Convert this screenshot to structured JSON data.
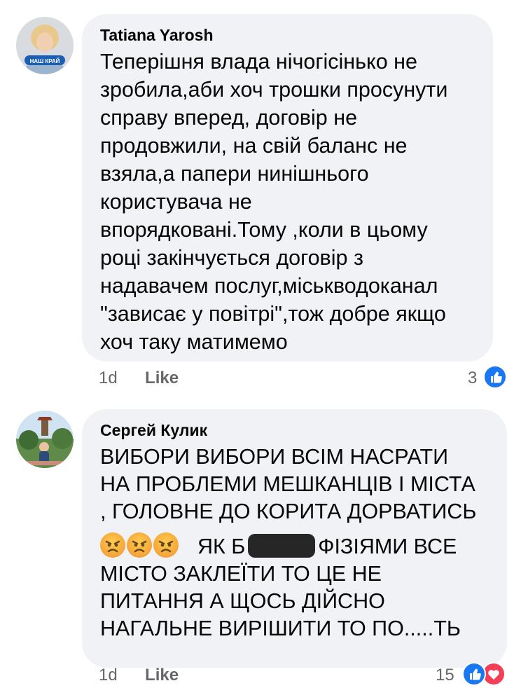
{
  "comments": [
    {
      "author": "Tatiana Yarosh",
      "avatar_badge": "НАШ КРАЙ",
      "lines": [
        "Теперішня влада нічогісінько не",
        "зробила,аби хоч трошки просунути",
        "справу вперед, договір не",
        "продовжили, на свій баланс не",
        "взяла,а папери нинішнього",
        "користувача не",
        "впорядковані.Тому ,коли в цьому",
        "році закінчується договір з",
        "надавачем послуг,міськводоканал",
        "\"зависає у повітрі\",тож добре якщо",
        "хоч таку матимемо"
      ],
      "time": "1d",
      "like_label": "Like",
      "reaction_count": "3",
      "reaction_icons": [
        "like-icon"
      ]
    },
    {
      "author": "Сергей Кулик",
      "lines_before_emoji": [
        "ВИБОРИ ВИБОРИ ВСІМ НАСРАТИ",
        "НА ПРОБЛЕМИ МЕШКАНЦІВ І МІСТА",
        ", ГОЛОВНЕ ДО КОРИТА ДОРВАТИСЬ"
      ],
      "emoji_icons": [
        "angry-face-icon",
        "angry-face-icon",
        "angry-face-icon"
      ],
      "emoji_line_text_start": "ЯК Б",
      "emoji_line_text_end": "ФІЗІЯМИ ВСЕ",
      "lines_after_emoji": [
        "МІСТО ЗАКЛЕЇТИ ТО ЦЕ НЕ",
        "ПИТАННЯ А ЩОСЬ ДІЙСНО",
        "НАГАЛЬНЕ ВИРІШИТИ ТО ПО.....ТЬ"
      ],
      "time": "1d",
      "like_label": "Like",
      "reaction_count": "15",
      "reaction_icons": [
        "like-icon",
        "love-icon"
      ]
    }
  ],
  "colors": {
    "bubble": "#f0f2f5",
    "meta_text": "#65676b",
    "like_blue": "#1877f2",
    "love_red": "#f33e58"
  }
}
